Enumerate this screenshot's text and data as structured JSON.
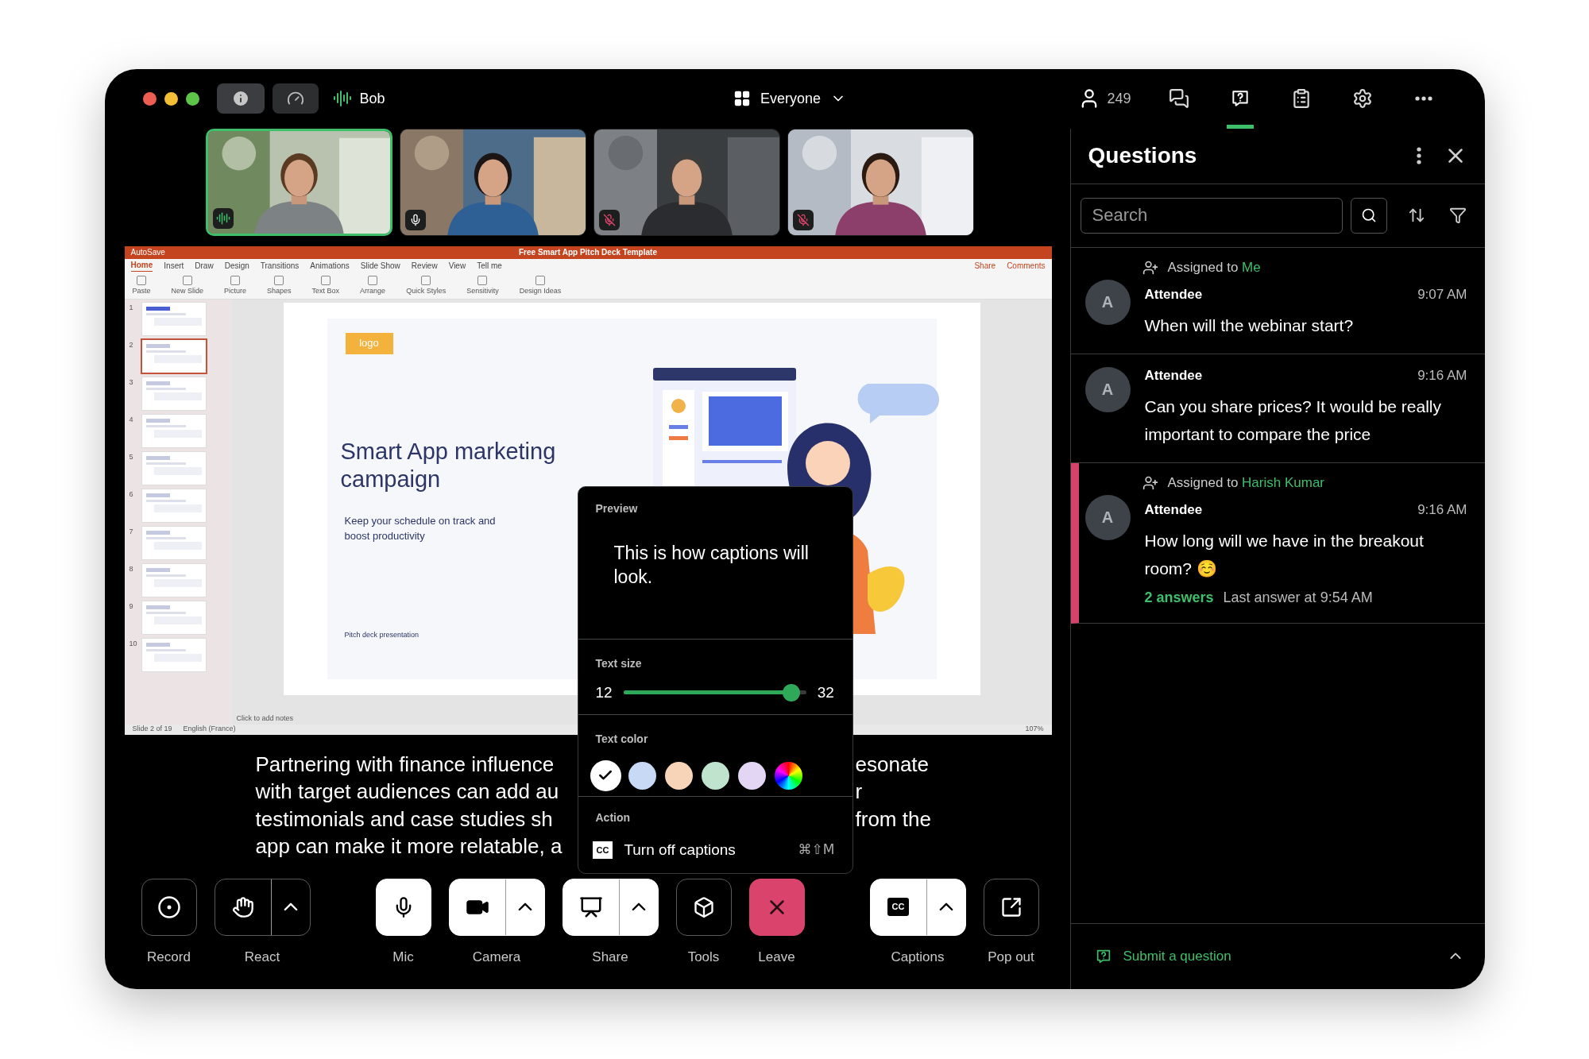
{
  "toolbar": {
    "speaker": "Bob",
    "audience": "Everyone",
    "participant_count": "249",
    "tabs": [
      {
        "kind": "chat",
        "selected": false
      },
      {
        "kind": "questions",
        "selected": true
      },
      {
        "kind": "notes",
        "selected": false
      },
      {
        "kind": "settings",
        "selected": false
      },
      {
        "kind": "more",
        "selected": false
      }
    ]
  },
  "video_tiles": [
    {
      "speaking": true,
      "muted": false,
      "kind": "picture"
    },
    {
      "speaking": false,
      "muted": false,
      "kind": "picture"
    },
    {
      "speaking": false,
      "muted": true,
      "kind": "picture"
    },
    {
      "speaking": false,
      "muted": true,
      "kind": "picture"
    }
  ],
  "shared_screen": {
    "autosave": "AutoSave",
    "app_title": "Free Smart App Pitch Deck Template",
    "share": "Share",
    "comments": "Comments",
    "ribbon_tabs": [
      {
        "label": "Home",
        "selected": true
      },
      {
        "label": "Insert",
        "selected": false
      },
      {
        "label": "Draw",
        "selected": false
      },
      {
        "label": "Design",
        "selected": false
      },
      {
        "label": "Transitions",
        "selected": false
      },
      {
        "label": "Animations",
        "selected": false
      },
      {
        "label": "Slide Show",
        "selected": false
      },
      {
        "label": "Review",
        "selected": false
      },
      {
        "label": "View",
        "selected": false
      },
      {
        "label": "Tell me",
        "selected": false
      }
    ],
    "ribbon_items": [
      "Paste",
      "New Slide",
      "Picture",
      "Shapes",
      "Text Box",
      "Arrange",
      "Quick Styles",
      "Sensitivity",
      "Design Ideas"
    ],
    "slides": [
      {
        "number": "1",
        "selected": false
      },
      {
        "number": "2",
        "selected": true
      },
      {
        "number": "3",
        "selected": false
      },
      {
        "number": "4",
        "selected": false
      },
      {
        "number": "5",
        "selected": false
      },
      {
        "number": "6",
        "selected": false
      },
      {
        "number": "7",
        "selected": false
      },
      {
        "number": "8",
        "selected": false
      },
      {
        "number": "9",
        "selected": false
      },
      {
        "number": "10",
        "selected": false
      }
    ],
    "slide": {
      "logo": "logo",
      "title": "Smart App marketing campaign",
      "subtitle": "Keep your schedule on track and boost productivity",
      "footer": "Pitch deck presentation"
    },
    "notes_placeholder": "Click to add notes",
    "status": "Slide 2 of 19",
    "language": "English (France)",
    "zoom": "107%"
  },
  "captions": [
    {
      "left": "Partnering with finance influence",
      "right": "esonate"
    },
    {
      "left": "with target audiences can add au",
      "right": "r"
    },
    {
      "left": "testimonials and case studies sh",
      "right": "from the"
    },
    {
      "left": "app can make it more relatable, a"
    }
  ],
  "caption_settings": {
    "preview_label": "Preview",
    "preview_text": "This is how captions will look.",
    "size_label": "Text size",
    "size_min": "12",
    "size_max": "32",
    "level": 0.92,
    "color_label": "Text color",
    "colors": [
      {
        "kind": "solid",
        "color": "#ffffff",
        "selected": true
      },
      {
        "kind": "solid",
        "color": "#c7d9f5",
        "selected": false
      },
      {
        "kind": "solid",
        "color": "#f7d4b8",
        "selected": false
      },
      {
        "kind": "solid",
        "color": "#bfe3cc",
        "selected": false
      },
      {
        "kind": "solid",
        "color": "#e3d6f5",
        "selected": false
      },
      {
        "kind": "custom",
        "selected": false
      }
    ],
    "action_label": "Action",
    "action_icon": "CC",
    "action": "Turn off captions",
    "shortcut": "⌘⇧M"
  },
  "control_groups": [
    [
      {
        "label": "Record",
        "kind": "record",
        "menu": false
      },
      {
        "label": "React",
        "kind": "react",
        "menu": true
      }
    ],
    [
      {
        "label": "Mic",
        "kind": "mic",
        "menu": false
      },
      {
        "label": "Camera",
        "kind": "camera",
        "menu": true
      },
      {
        "label": "Share",
        "kind": "share",
        "menu": true
      },
      {
        "label": "Tools",
        "kind": "tools",
        "menu": false
      },
      {
        "label": "Leave",
        "kind": "leave",
        "menu": false
      }
    ],
    [
      {
        "label": "Captions",
        "kind": "captions",
        "menu": true,
        "icon_text": "CC"
      },
      {
        "label": "Pop out",
        "kind": "popout",
        "menu": false
      }
    ]
  ],
  "questions_panel": {
    "title": "Questions",
    "search_placeholder": "Search",
    "questions": [
      {
        "assigned_label": "Assigned to",
        "assignee": "Me",
        "avatar": "A",
        "author": "Attendee",
        "time": "9:07 AM",
        "text": "When will the webinar start?",
        "flagged": false
      },
      {
        "avatar": "A",
        "author": "Attendee",
        "time": "9:16 AM",
        "text": "Can you share prices? It would be really important to compare the price",
        "flagged": false
      },
      {
        "assigned_label": "Assigned to",
        "assignee": "Harish Kumar",
        "avatar": "A",
        "author": "Attendee",
        "time": "9:16 AM",
        "text": "How long will we have in the breakout room? ☺️",
        "flagged": true,
        "answers": "2 answers",
        "last_answer": "Last answer at 9:54 AM"
      }
    ],
    "submit": "Submit a question"
  }
}
